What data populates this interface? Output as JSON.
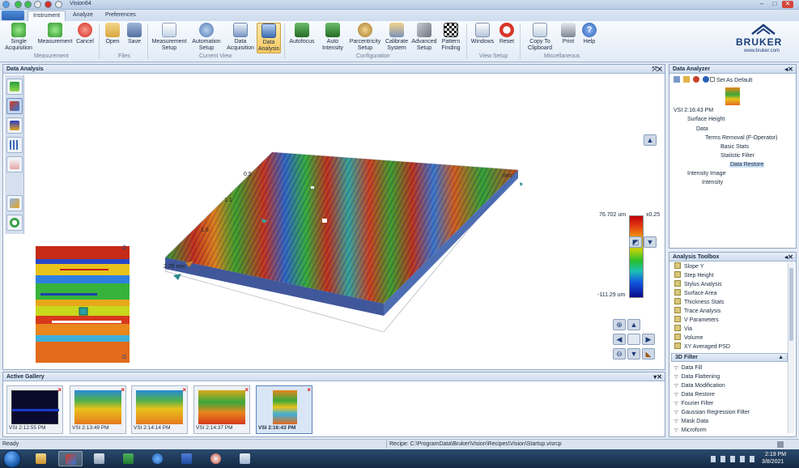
{
  "window": {
    "title": "Vision64"
  },
  "tabs": [
    {
      "label": "Instrument"
    },
    {
      "label": "Analyze"
    },
    {
      "label": "Preferences"
    }
  ],
  "ribbon": {
    "buttons": [
      {
        "label": "Single\nAcquisition",
        "icon": "play-green-icon"
      },
      {
        "label": "Measurement",
        "icon": "play-icon"
      },
      {
        "label": "Cancel",
        "icon": "cancel-icon"
      },
      {
        "label": "Open",
        "icon": "folder-icon"
      },
      {
        "label": "Save",
        "icon": "save-icon"
      },
      {
        "label": "Measurement\nSetup",
        "icon": "measurement-setup-icon"
      },
      {
        "label": "Automation\nSetup",
        "icon": "automation-icon"
      },
      {
        "label": "Data\nAcquisition",
        "icon": "data-acquisition-icon"
      },
      {
        "label": "Data\nAnalysis",
        "icon": "data-analysis-icon"
      },
      {
        "label": "Autofocus",
        "icon": "autofocus-icon"
      },
      {
        "label": "Auto\nIntensity",
        "icon": "auto-intensity-icon"
      },
      {
        "label": "Parcentricity\nSetup",
        "icon": "parcentricity-icon"
      },
      {
        "label": "Calibrate\nSystem",
        "icon": "calibrate-icon"
      },
      {
        "label": "Advanced\nSetup",
        "icon": "advanced-setup-icon"
      },
      {
        "label": "Pattern\nFinding",
        "icon": "pattern-finding-icon"
      },
      {
        "label": "Windows",
        "icon": "windows-icon"
      },
      {
        "label": "Reset",
        "icon": "reset-icon"
      },
      {
        "label": "Copy To\nClipboard",
        "icon": "clipboard-icon"
      },
      {
        "label": "Print",
        "icon": "print-icon"
      },
      {
        "label": "Help",
        "icon": "help-icon"
      }
    ],
    "groups": [
      "Measurement",
      "Files",
      "Current View",
      "Configuration",
      "View Setup",
      "Miscellaneous"
    ],
    "logo": {
      "name": "BRUKER",
      "url": "www.bruker.com"
    }
  },
  "data_analysis": {
    "title": "Data Analysis",
    "axes": {
      "y_ticks": [
        "0.5",
        "1.1",
        "1.6",
        "2.25 mm"
      ],
      "x_end": "mm"
    },
    "colorbar": {
      "max": "76.702 um",
      "min": "-111.29 um",
      "scale": "x0.25"
    }
  },
  "gallery": {
    "title": "Active Gallery",
    "items": [
      {
        "label": "VSI 2:12:55 PM"
      },
      {
        "label": "VSI 2:13:49 PM"
      },
      {
        "label": "VSI 2:14:14 PM"
      },
      {
        "label": "VSI 2:14:37 PM"
      },
      {
        "label": "VSI 2:16:43 PM"
      }
    ]
  },
  "analyzer": {
    "title": "Data Analyzer",
    "set_default": "Set As Default",
    "tree": [
      {
        "label": "VSI 2:16:43 PM"
      },
      {
        "label": "Surface Height"
      },
      {
        "label": "Data"
      },
      {
        "label": "Terms Removal (F-Operator)"
      },
      {
        "label": "Basic Stats"
      },
      {
        "label": "Statistic Filter"
      },
      {
        "label": "Data Restore"
      },
      {
        "label": "Intensity Image"
      },
      {
        "label": "Intensity"
      }
    ]
  },
  "toolbox": {
    "title": "Analysis Toolbox",
    "items": [
      {
        "label": "Slope Y"
      },
      {
        "label": "Step Height"
      },
      {
        "label": "Stylus Analysis"
      },
      {
        "label": "Surface Area"
      },
      {
        "label": "Thickness Stats"
      },
      {
        "label": "Trace Analysis"
      },
      {
        "label": "V Parameters"
      },
      {
        "label": "Via"
      },
      {
        "label": "Volume"
      },
      {
        "label": "XY Averaged PSD"
      }
    ],
    "filter_header": "3D Filter",
    "filters": [
      {
        "label": "Data Fill"
      },
      {
        "label": "Data Flattening"
      },
      {
        "label": "Data Modification"
      },
      {
        "label": "Data Restore"
      },
      {
        "label": "Fourier Filter"
      },
      {
        "label": "Gaussian Regression Filter"
      },
      {
        "label": "Mask Data"
      },
      {
        "label": "Microform"
      }
    ]
  },
  "status": {
    "ready": "Ready",
    "recipe": "Recipe: C:\\ProgramData\\Bruker\\Vision\\Recipes\\Vision\\Startup.visrcp"
  },
  "clock": {
    "time": "2:19 PM",
    "date": "3/8/2021"
  }
}
